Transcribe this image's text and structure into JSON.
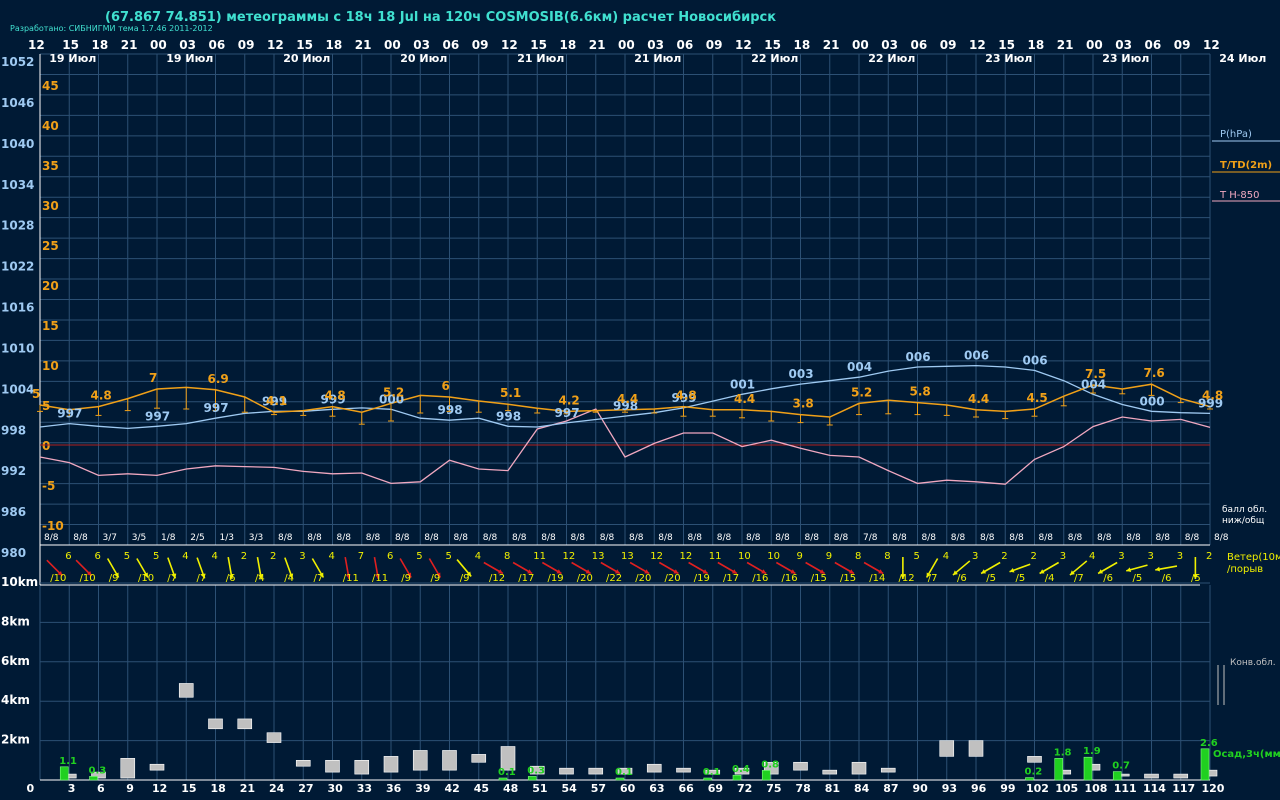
{
  "header": {
    "title": "(67.867 74.851) метеограммы с  18ч 18 Jul на 120ч COSMOSIB(6.6км) расчет Новосибирск",
    "credit": "Разработано: СИБНИГМИ тема 1.7.46 2011-2012"
  },
  "colors": {
    "background": "#001a35",
    "grid": "#2c5074",
    "pressure": "#9fcaf2",
    "temperature": "#f0a018",
    "t850": "#f0a8c0",
    "zero_line": "#b02020",
    "wind_yellow": "#f0f000",
    "wind_red": "#e02020",
    "precip": "#20d020",
    "cloud": "#c0c0c0",
    "header_text": "#40e0d0"
  },
  "hour_axis": [
    "12",
    "15",
    "18",
    "21",
    "00",
    "03",
    "06",
    "09",
    "12",
    "15",
    "18",
    "21",
    "00",
    "03",
    "06",
    "09",
    "12",
    "15",
    "18",
    "21",
    "00",
    "03",
    "06",
    "09",
    "12",
    "15",
    "18",
    "21",
    "00",
    "03",
    "06",
    "09",
    "12",
    "15",
    "18",
    "21",
    "00",
    "03",
    "06",
    "09",
    "12"
  ],
  "day_labels": [
    {
      "label": "19 Июл",
      "col": 1
    },
    {
      "label": "19 Июл",
      "col": 5
    },
    {
      "label": "20 Июл",
      "col": 9
    },
    {
      "label": "20 Июл",
      "col": 13
    },
    {
      "label": "21 Июл",
      "col": 17
    },
    {
      "label": "21 Июл",
      "col": 21
    },
    {
      "label": "22 Июл",
      "col": 25
    },
    {
      "label": "22 Июл",
      "col": 29
    },
    {
      "label": "23 Июл",
      "col": 33
    },
    {
      "label": "23 Июл",
      "col": 37
    },
    {
      "label": "24 Июл",
      "col": 41
    }
  ],
  "pressure_axis_labels": [
    "1052",
    "1046",
    "1040",
    "1034",
    "1028",
    "1022",
    "1016",
    "1010",
    "1004",
    "998",
    "992",
    "986",
    "980"
  ],
  "temp_axis_labels": [
    "45",
    "40",
    "35",
    "30",
    "25",
    "20",
    "15",
    "10",
    "5",
    "0",
    "-5",
    "-10"
  ],
  "legend": {
    "pressure": "P(hPa)",
    "temperature": "T/TD(2m)",
    "t850": "T H-850",
    "cloud_cover": "балл обл.",
    "cloud_cover2": "ниж/общ",
    "wind": "Ветер(10м)",
    "wind2": "/порыв",
    "convective": "Конв.обл.",
    "precip": "Осад,3ч(мм)"
  },
  "height_axis_labels": [
    "10km",
    "8km",
    "6km",
    "4km",
    "2km"
  ],
  "forecast_hours": [
    "0",
    "3",
    "6",
    "9",
    "12",
    "15",
    "18",
    "21",
    "24",
    "27",
    "30",
    "33",
    "36",
    "39",
    "42",
    "45",
    "48",
    "51",
    "54",
    "57",
    "60",
    "63",
    "66",
    "69",
    "72",
    "75",
    "78",
    "81",
    "84",
    "87",
    "90",
    "93",
    "96",
    "99",
    "102",
    "105",
    "108",
    "111",
    "114",
    "117",
    "120"
  ],
  "chart_data": {
    "type": "line",
    "x": [
      0,
      3,
      6,
      9,
      12,
      15,
      18,
      21,
      24,
      27,
      30,
      33,
      36,
      39,
      42,
      45,
      48,
      51,
      54,
      57,
      60,
      63,
      66,
      69,
      72,
      75,
      78,
      81,
      84,
      87,
      90,
      93,
      96,
      99,
      102,
      105,
      108,
      111,
      114,
      117,
      120
    ],
    "pressure_hpa": [
      997.3,
      997.8,
      997.4,
      997.1,
      997.4,
      997.8,
      998.6,
      999.3,
      999.6,
      999.6,
      999.9,
      1000.1,
      999.9,
      998.6,
      998.3,
      998.6,
      997.4,
      997.3,
      997.9,
      998.4,
      998.9,
      999.4,
      1000.1,
      1001.1,
      1002.1,
      1002.9,
      1003.6,
      1004.1,
      1004.6,
      1005.5,
      1006.1,
      1006.2,
      1006.3,
      1006.1,
      1005.6,
      1004.1,
      1002.1,
      1000.6,
      999.6,
      999.4,
      999.3
    ],
    "pressure_labels": [
      {
        "i": 1,
        "text": "997"
      },
      {
        "i": 4,
        "text": "997"
      },
      {
        "i": 6,
        "text": "997"
      },
      {
        "i": 8,
        "text": "999"
      },
      {
        "i": 10,
        "text": "999"
      },
      {
        "i": 12,
        "text": "000"
      },
      {
        "i": 14,
        "text": "998"
      },
      {
        "i": 16,
        "text": "998"
      },
      {
        "i": 18,
        "text": "997"
      },
      {
        "i": 20,
        "text": "998"
      },
      {
        "i": 22,
        "text": "999"
      },
      {
        "i": 24,
        "text": "001"
      },
      {
        "i": 26,
        "text": "003"
      },
      {
        "i": 28,
        "text": "004"
      },
      {
        "i": 30,
        "text": "006"
      },
      {
        "i": 32,
        "text": "006"
      },
      {
        "i": 34,
        "text": "006"
      },
      {
        "i": 36,
        "text": "004"
      },
      {
        "i": 38,
        "text": "000"
      },
      {
        "i": 40,
        "text": "999"
      }
    ],
    "temperature_c": [
      5,
      4.4,
      4.8,
      5.8,
      7,
      7.2,
      6.9,
      6,
      4.1,
      4.3,
      4.8,
      4.1,
      5.2,
      6.2,
      6,
      5.5,
      5.1,
      4.6,
      4.2,
      4.3,
      4.4,
      4.5,
      4.8,
      4.4,
      4.4,
      4.2,
      3.8,
      3.5,
      5.2,
      5.6,
      5.3,
      5,
      4.4,
      4.2,
      4.5,
      6.1,
      7.5,
      7,
      7.6,
      5.8,
      4.8
    ],
    "temperature_labels": [
      {
        "i": 0,
        "text": "5"
      },
      {
        "i": 2,
        "text": "4.8"
      },
      {
        "i": 4,
        "text": "7"
      },
      {
        "i": 6,
        "text": "6.9"
      },
      {
        "i": 8,
        "text": "4.1"
      },
      {
        "i": 10,
        "text": "4.8"
      },
      {
        "i": 12,
        "text": "5.2"
      },
      {
        "i": 14,
        "text": "6"
      },
      {
        "i": 16,
        "text": "5.1"
      },
      {
        "i": 18,
        "text": "4.2"
      },
      {
        "i": 20,
        "text": "4.4"
      },
      {
        "i": 22,
        "text": "4.8"
      },
      {
        "i": 24,
        "text": "4.4"
      },
      {
        "i": 26,
        "text": "3.8"
      },
      {
        "i": 28,
        "text": "5.2"
      },
      {
        "i": 30,
        "text": "5.8"
      },
      {
        "i": 32,
        "text": "4.4"
      },
      {
        "i": 34,
        "text": "4.5"
      },
      {
        "i": 36,
        "text": "7.5"
      },
      {
        "i": 38,
        "text": "7.6"
      },
      {
        "i": 40,
        "text": "4.8"
      }
    ],
    "dewpoint_c": [
      4.2,
      3.6,
      3.7,
      4.3,
      4.6,
      4.5,
      4.3,
      4.1,
      3.8,
      3.7,
      3.6,
      2.6,
      3.0,
      4.0,
      4.2,
      4.1,
      4.3,
      4.0,
      3.9,
      4.1,
      4.1,
      4.0,
      3.6,
      3.6,
      3.4,
      3.0,
      2.8,
      2.5,
      3.8,
      3.9,
      3.8,
      3.7,
      3.5,
      3.3,
      3.6,
      4.9,
      6.5,
      6.4,
      6.2,
      5.3,
      4.5
    ],
    "t850_c": [
      -1.5,
      -2.2,
      -3.8,
      -3.6,
      -3.8,
      -3.0,
      -2.6,
      -2.7,
      -2.8,
      -3.3,
      -3.6,
      -3.5,
      -4.8,
      -4.6,
      -1.9,
      -3.0,
      -3.2,
      2.0,
      3.0,
      4.5,
      -1.5,
      0.2,
      1.5,
      1.5,
      -0.2,
      0.6,
      -0.4,
      -1.3,
      -1.5,
      -3.2,
      -4.8,
      -4.4,
      -4.6,
      -4.9,
      -1.8,
      -0.2,
      2.3,
      3.5,
      3.0,
      3.2,
      2.2
    ],
    "cloud_cover_labels": [
      "8/8",
      "8/8",
      "3/7",
      "3/5",
      "1/8",
      "2/5",
      "1/3",
      "3/3",
      "8/8",
      "8/8",
      "8/8",
      "8/8",
      "8/8",
      "8/8",
      "8/8",
      "8/8",
      "8/8",
      "8/8",
      "8/8",
      "8/8",
      "8/8",
      "8/8",
      "8/8",
      "8/8",
      "8/8",
      "8/8",
      "8/8",
      "8/8",
      "7/8",
      "8/8",
      "8/8",
      "8/8",
      "8/8",
      "8/8",
      "8/8",
      "8/8",
      "8/8",
      "8/8",
      "8/8",
      "8/8",
      "8/8"
    ],
    "wind_speed": [
      "6",
      "6",
      "5",
      "5",
      "4",
      "4",
      "2",
      "2",
      "3",
      "4",
      "7",
      "6",
      "5",
      "5",
      "4",
      "8",
      "11",
      "12",
      "13",
      "13",
      "12",
      "12",
      "11",
      "10",
      "10",
      "9",
      "9",
      "8",
      "8",
      "5",
      "4",
      "3",
      "2",
      "2",
      "3",
      "4",
      "3",
      "3",
      "3",
      "2"
    ],
    "wind_gust": [
      "/10",
      "/10",
      "/9",
      "/10",
      "/7",
      "/7",
      "/6",
      "/4",
      "/4",
      "/7",
      "/11",
      "/11",
      "/9",
      "/9",
      "/9",
      "/12",
      "/17",
      "/19",
      "/20",
      "/22",
      "/20",
      "/20",
      "/19",
      "/17",
      "/16",
      "/16",
      "/15",
      "/15",
      "/14",
      "/12",
      "/7",
      "/6",
      "/5",
      "/5",
      "/4",
      "/7",
      "/6",
      "/5",
      "/6",
      "/5"
    ],
    "wind_dir_deg": [
      45,
      45,
      60,
      60,
      70,
      70,
      80,
      80,
      70,
      60,
      80,
      80,
      60,
      60,
      50,
      30,
      30,
      30,
      30,
      30,
      30,
      30,
      30,
      30,
      30,
      30,
      30,
      30,
      30,
      90,
      120,
      140,
      150,
      160,
      150,
      140,
      150,
      165,
      170,
      90
    ],
    "wind_color": [
      "r",
      "r",
      "y",
      "y",
      "y",
      "y",
      "y",
      "y",
      "y",
      "y",
      "r",
      "r",
      "r",
      "r",
      "y",
      "r",
      "r",
      "r",
      "r",
      "r",
      "r",
      "r",
      "r",
      "r",
      "r",
      "r",
      "r",
      "r",
      "r",
      "y",
      "y",
      "y",
      "y",
      "y",
      "y",
      "y",
      "y",
      "y",
      "y",
      "y"
    ],
    "precip_mm": [
      {
        "i": 1,
        "value": 1.1,
        "label": "1.1"
      },
      {
        "i": 2,
        "value": 0.3,
        "label": "0.3"
      },
      {
        "i": 16,
        "value": 0.1,
        "label": "0.1"
      },
      {
        "i": 17,
        "value": 0.3,
        "label": "0.3"
      },
      {
        "i": 20,
        "value": 0.1,
        "label": "0.1"
      },
      {
        "i": 23,
        "value": 0.1,
        "label": "0.1"
      },
      {
        "i": 24,
        "value": 0.4,
        "label": "0.4"
      },
      {
        "i": 25,
        "value": 0.8,
        "label": "0.8"
      },
      {
        "i": 34,
        "value": 0.2,
        "label": "0.2"
      },
      {
        "i": 35,
        "value": 1.8,
        "label": "1.8"
      },
      {
        "i": 36,
        "value": 1.9,
        "label": "1.9"
      },
      {
        "i": 37,
        "value": 0.7,
        "label": "0.7"
      },
      {
        "i": 40,
        "value": 2.6,
        "label": "2.6"
      }
    ],
    "cloud_layers_km": [
      {
        "i": 1,
        "bottom": 0.1,
        "top": 0.3
      },
      {
        "i": 2,
        "bottom": 0.1,
        "top": 0.4
      },
      {
        "i": 3,
        "bottom": 0.1,
        "top": 1.1
      },
      {
        "i": 4,
        "bottom": 0.5,
        "top": 0.8
      },
      {
        "i": 5,
        "bottom": 4.2,
        "top": 4.9
      },
      {
        "i": 6,
        "bottom": 2.6,
        "top": 3.1
      },
      {
        "i": 7,
        "bottom": 2.6,
        "top": 3.1
      },
      {
        "i": 8,
        "bottom": 1.9,
        "top": 2.4
      },
      {
        "i": 9,
        "bottom": 0.7,
        "top": 1.0
      },
      {
        "i": 10,
        "bottom": 0.4,
        "top": 1.0
      },
      {
        "i": 11,
        "bottom": 0.3,
        "top": 1.0
      },
      {
        "i": 12,
        "bottom": 0.4,
        "top": 1.2
      },
      {
        "i": 13,
        "bottom": 0.5,
        "top": 1.5
      },
      {
        "i": 14,
        "bottom": 0.5,
        "top": 1.5
      },
      {
        "i": 15,
        "bottom": 0.9,
        "top": 1.3
      },
      {
        "i": 16,
        "bottom": 0.5,
        "top": 1.7
      },
      {
        "i": 17,
        "bottom": 0.3,
        "top": 0.7
      },
      {
        "i": 18,
        "bottom": 0.3,
        "top": 0.6
      },
      {
        "i": 19,
        "bottom": 0.3,
        "top": 0.6
      },
      {
        "i": 20,
        "bottom": 0.3,
        "top": 0.6
      },
      {
        "i": 21,
        "bottom": 0.4,
        "top": 0.8
      },
      {
        "i": 22,
        "bottom": 0.4,
        "top": 0.6
      },
      {
        "i": 23,
        "bottom": 0.3,
        "top": 0.5
      },
      {
        "i": 24,
        "bottom": 0.3,
        "top": 0.6
      },
      {
        "i": 25,
        "bottom": 0.3,
        "top": 0.9
      },
      {
        "i": 26,
        "bottom": 0.5,
        "top": 0.9
      },
      {
        "i": 27,
        "bottom": 0.3,
        "top": 0.5
      },
      {
        "i": 28,
        "bottom": 0.3,
        "top": 0.9
      },
      {
        "i": 29,
        "bottom": 0.4,
        "top": 0.6
      },
      {
        "i": 31,
        "bottom": 1.2,
        "top": 2.0
      },
      {
        "i": 32,
        "bottom": 1.2,
        "top": 2.0
      },
      {
        "i": 34,
        "bottom": 0.9,
        "top": 1.2
      },
      {
        "i": 35,
        "bottom": 0.3,
        "top": 0.5
      },
      {
        "i": 36,
        "bottom": 0.5,
        "top": 0.8
      },
      {
        "i": 37,
        "bottom": 0.2,
        "top": 0.3
      },
      {
        "i": 38,
        "bottom": 0.1,
        "top": 0.3
      },
      {
        "i": 39,
        "bottom": 0.1,
        "top": 0.3
      },
      {
        "i": 40,
        "bottom": 0.2,
        "top": 0.5
      }
    ],
    "pressure_range": [
      980,
      1052
    ],
    "temperature_range": [
      -12,
      50
    ],
    "height_range_km": [
      0,
      10.5
    ],
    "grid": true
  }
}
